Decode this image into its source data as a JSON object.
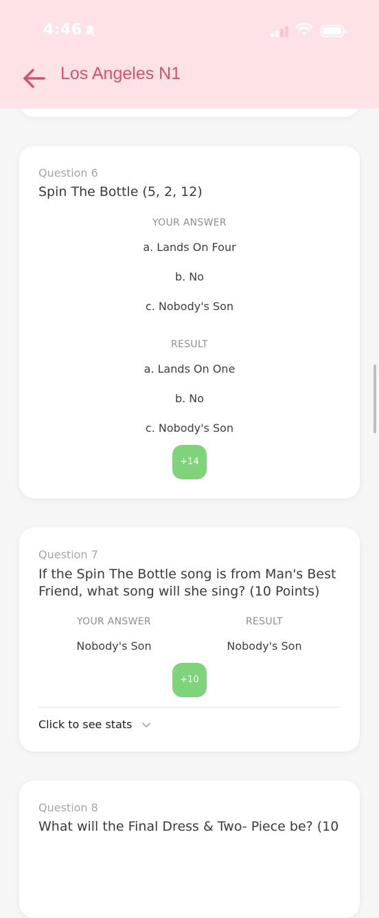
{
  "status_bar": {
    "time": "4:46"
  },
  "header": {
    "title": "Los Angeles N1"
  },
  "questions": [
    {
      "label": "Question 6",
      "text": "Spin The Bottle (5, 2, 12)",
      "your_answer_label": "YOUR ANSWER",
      "your_answers": [
        "a. Lands On Four",
        "b. No",
        "c. Nobody's Son"
      ],
      "result_label": "RESULT",
      "results": [
        "a. Lands On One",
        "b. No",
        "c. Nobody's Son"
      ],
      "points": "+14"
    },
    {
      "label": "Question 7",
      "text": "If the Spin The Bottle song is from Man's Best Friend, what song will she sing? (10 Points)",
      "your_answer_label": "YOUR ANSWER",
      "your_answer": "Nobody's Son",
      "result_label": "RESULT",
      "result": "Nobody's Son",
      "points": "+10",
      "stats_link": "Click to see stats"
    },
    {
      "label": "Question 8",
      "text": "What will the Final Dress & Two- Piece be? (10"
    }
  ],
  "colors": {
    "header_bg": "#fde2e6",
    "title": "#d8506b",
    "points_bg": "#7fd37a"
  }
}
